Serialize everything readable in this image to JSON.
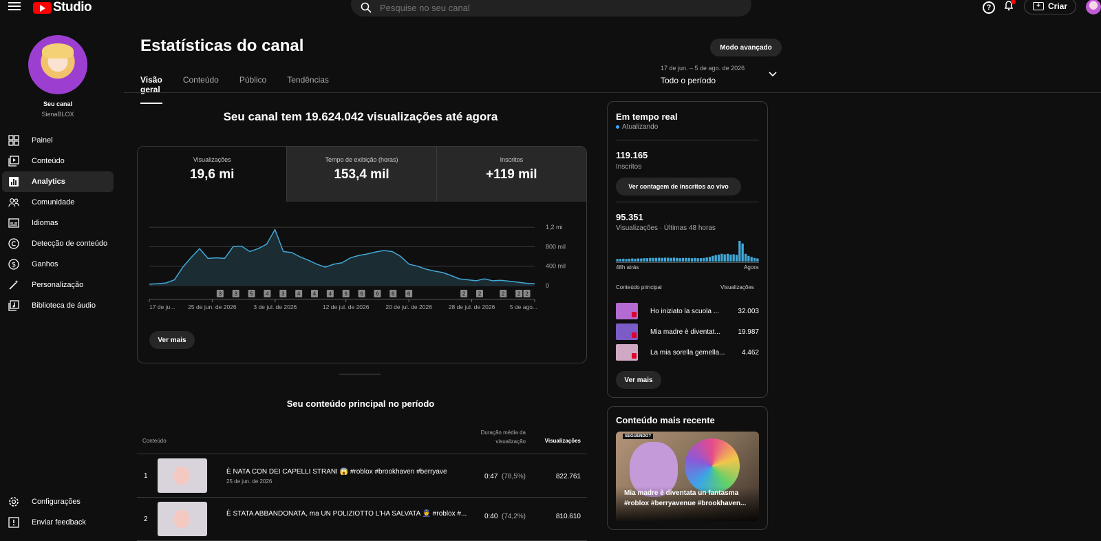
{
  "app": {
    "logo_text": "Studio"
  },
  "search": {
    "placeholder": "Pesquise no seu canal"
  },
  "header": {
    "help_icon": "?",
    "create_label": "Criar"
  },
  "sidebar": {
    "channel_label": "Seu canal",
    "channel_name": "SienaBLOX",
    "items": [
      {
        "label": "Painel",
        "icon": "dashboard-icon"
      },
      {
        "label": "Conteúdo",
        "icon": "content-icon"
      },
      {
        "label": "Analytics",
        "icon": "analytics-icon",
        "active": true
      },
      {
        "label": "Comunidade",
        "icon": "community-icon"
      },
      {
        "label": "Idiomas",
        "icon": "subtitles-icon"
      },
      {
        "label": "Detecção de conteúdo",
        "icon": "copyright-icon"
      },
      {
        "label": "Ganhos",
        "icon": "dollar-icon"
      },
      {
        "label": "Personalização",
        "icon": "magic-wand-icon"
      },
      {
        "label": "Biblioteca de áudio",
        "icon": "audio-library-icon"
      }
    ],
    "bottom": [
      {
        "label": "Configurações",
        "icon": "gear-icon"
      },
      {
        "label": "Enviar feedback",
        "icon": "feedback-icon"
      }
    ]
  },
  "page": {
    "title": "Estatísticas do canal",
    "advanced_button": "Modo avançado",
    "tabs": [
      "Visão geral",
      "Conteúdo",
      "Público",
      "Tendências"
    ],
    "period_range": "17 de jun. – 5 de ago. de 2026",
    "period_label": "Todo o período",
    "headline": "Seu canal tem 19.624.042 visualizações até agora"
  },
  "metrics": [
    {
      "label": "Visualizações",
      "value": "19,6 mi"
    },
    {
      "label": "Tempo de exibição (horas)",
      "value": "153,4 mil"
    },
    {
      "label": "Inscritos",
      "value": "+119 mil"
    }
  ],
  "chart_data": {
    "type": "area",
    "series": [
      {
        "values": [
          30,
          40,
          55,
          120,
          380,
          580,
          760,
          560,
          570,
          560,
          800,
          810,
          700,
          760,
          850,
          1150,
          700,
          680,
          590,
          520,
          440,
          380,
          440,
          470,
          570,
          620,
          650,
          690,
          720,
          700,
          600,
          440,
          400,
          340,
          300,
          270,
          210,
          140,
          120,
          100,
          140,
          100,
          110,
          90,
          70,
          50,
          40
        ]
      }
    ],
    "ylim": [
      0,
      1300
    ],
    "y_ticks": [
      "0",
      "400 mil",
      "800 mil",
      "1,2 mi"
    ],
    "y_tick_values": [
      0,
      400,
      800,
      1200
    ],
    "x_ticks": [
      "17 de ju...",
      "25 de jun. de 2026",
      "3 de jul. de 2026",
      "12 de jul. de 2026",
      "20 de jul. de 2026",
      "28 de jul. de 2026",
      "5 de ago..."
    ],
    "x_tick_positions": [
      0,
      8,
      16,
      25,
      33,
      41,
      49
    ],
    "days": 50,
    "markers": [
      {
        "day": 9,
        "label": "3"
      },
      {
        "day": 11,
        "label": "3"
      },
      {
        "day": 13,
        "label": "5"
      },
      {
        "day": 15,
        "label": "4"
      },
      {
        "day": 17,
        "label": "3"
      },
      {
        "day": 19,
        "label": "4"
      },
      {
        "day": 21,
        "label": "4"
      },
      {
        "day": 23,
        "label": "4"
      },
      {
        "day": 25,
        "label": "6"
      },
      {
        "day": 27,
        "label": "6"
      },
      {
        "day": 29,
        "label": "6"
      },
      {
        "day": 31,
        "label": "6"
      },
      {
        "day": 33,
        "label": "6"
      },
      {
        "day": 40,
        "label": "2"
      },
      {
        "day": 42,
        "label": "2"
      },
      {
        "day": 45,
        "label": "2"
      },
      {
        "day": 47,
        "label": "2"
      },
      {
        "day": 48,
        "label": "2"
      }
    ]
  },
  "chart_more": "Ver mais",
  "top_content": {
    "title": "Seu conteúdo principal no período",
    "col_content": "Conteúdo",
    "col_duration": "Duração média da visualização",
    "col_views": "Visualizações",
    "rows": [
      {
        "idx": "1",
        "title": "È NATA CON DEI CAPELLI STRANI 😱 #roblox #brookhaven #berryave",
        "date": "25 de jun. de 2026",
        "duration": "0:47",
        "pct": "(78,5%)",
        "views": "822.761"
      },
      {
        "idx": "2",
        "title": "È STATA ABBANDONATA, ma UN POLIZIOTTO L'HA SALVATA 👮 #roblox #...",
        "date": "",
        "duration": "0:40",
        "pct": "(74,2%)",
        "views": "810.610"
      }
    ]
  },
  "realtime": {
    "title": "Em tempo real",
    "status": "Atualizando",
    "subs_value": "119.165",
    "subs_label": "Inscritos",
    "subs_button": "Ver contagem de inscritos ao vivo",
    "views_value": "95.351",
    "views_label": "Visualizações · Últimas 48 horas",
    "bar_values": [
      10,
      10,
      11,
      10,
      11,
      12,
      11,
      12,
      12,
      13,
      13,
      14,
      14,
      14,
      15,
      14,
      15,
      15,
      14,
      15,
      14,
      13,
      14,
      14,
      14,
      13,
      14,
      13,
      13,
      14,
      16,
      18,
      22,
      25,
      27,
      30,
      28,
      30,
      27,
      28,
      26,
      80,
      70,
      30,
      22,
      18,
      14,
      12
    ],
    "axis_left": "48h atrás",
    "axis_right": "Agora",
    "col_content": "Conteúdo principal",
    "col_views": "Visualizações",
    "items": [
      {
        "name": "Ho iniziato la scuola ...",
        "views": "32.003"
      },
      {
        "name": "Mia madre è diventat...",
        "views": "19.987"
      },
      {
        "name": "La mia sorella gemella...",
        "views": "4.462"
      }
    ],
    "more": "Ver mais"
  },
  "recent": {
    "title": "Conteúdo mais recente",
    "badge": "SEGUENDO?",
    "caption": "Mia madre è diventata un fantasma #roblox #berryavenue #brookhaven..."
  }
}
